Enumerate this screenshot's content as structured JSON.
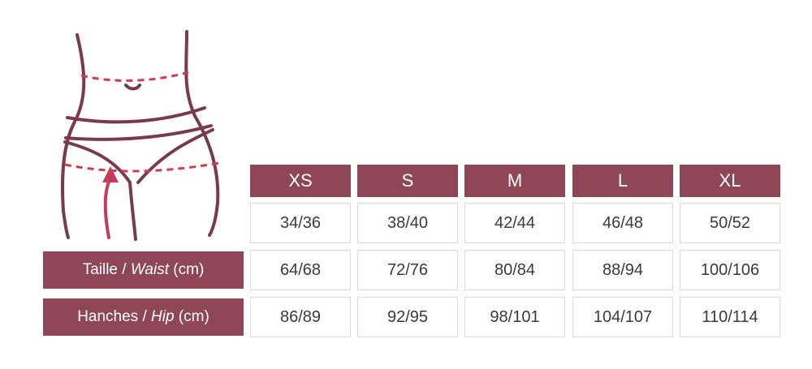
{
  "colors": {
    "accent": "#8e4658",
    "dash": "#d23c4a",
    "line": "#7a3a4e",
    "cell_border": "#d9d9d9"
  },
  "icons": {
    "figure": "body-waist-hip-diagram-icon",
    "arrow": "up-arrow-icon"
  },
  "sizes": [
    "XS",
    "S",
    "M",
    "L",
    "XL"
  ],
  "rows": [
    {
      "label_pre": "",
      "label_em": "",
      "label_post": "",
      "values": [
        "34/36",
        "38/40",
        "42/44",
        "46/48",
        "50/52"
      ]
    },
    {
      "label_pre": "Taille / ",
      "label_em": "Waist",
      "label_post": " (cm)",
      "values": [
        "64/68",
        "72/76",
        "80/84",
        "88/94",
        "100/106"
      ]
    },
    {
      "label_pre": "Hanches / ",
      "label_em": "Hip",
      "label_post": " (cm)",
      "values": [
        "86/89",
        "92/95",
        "98/101",
        "104/107",
        "110/114"
      ]
    }
  ]
}
